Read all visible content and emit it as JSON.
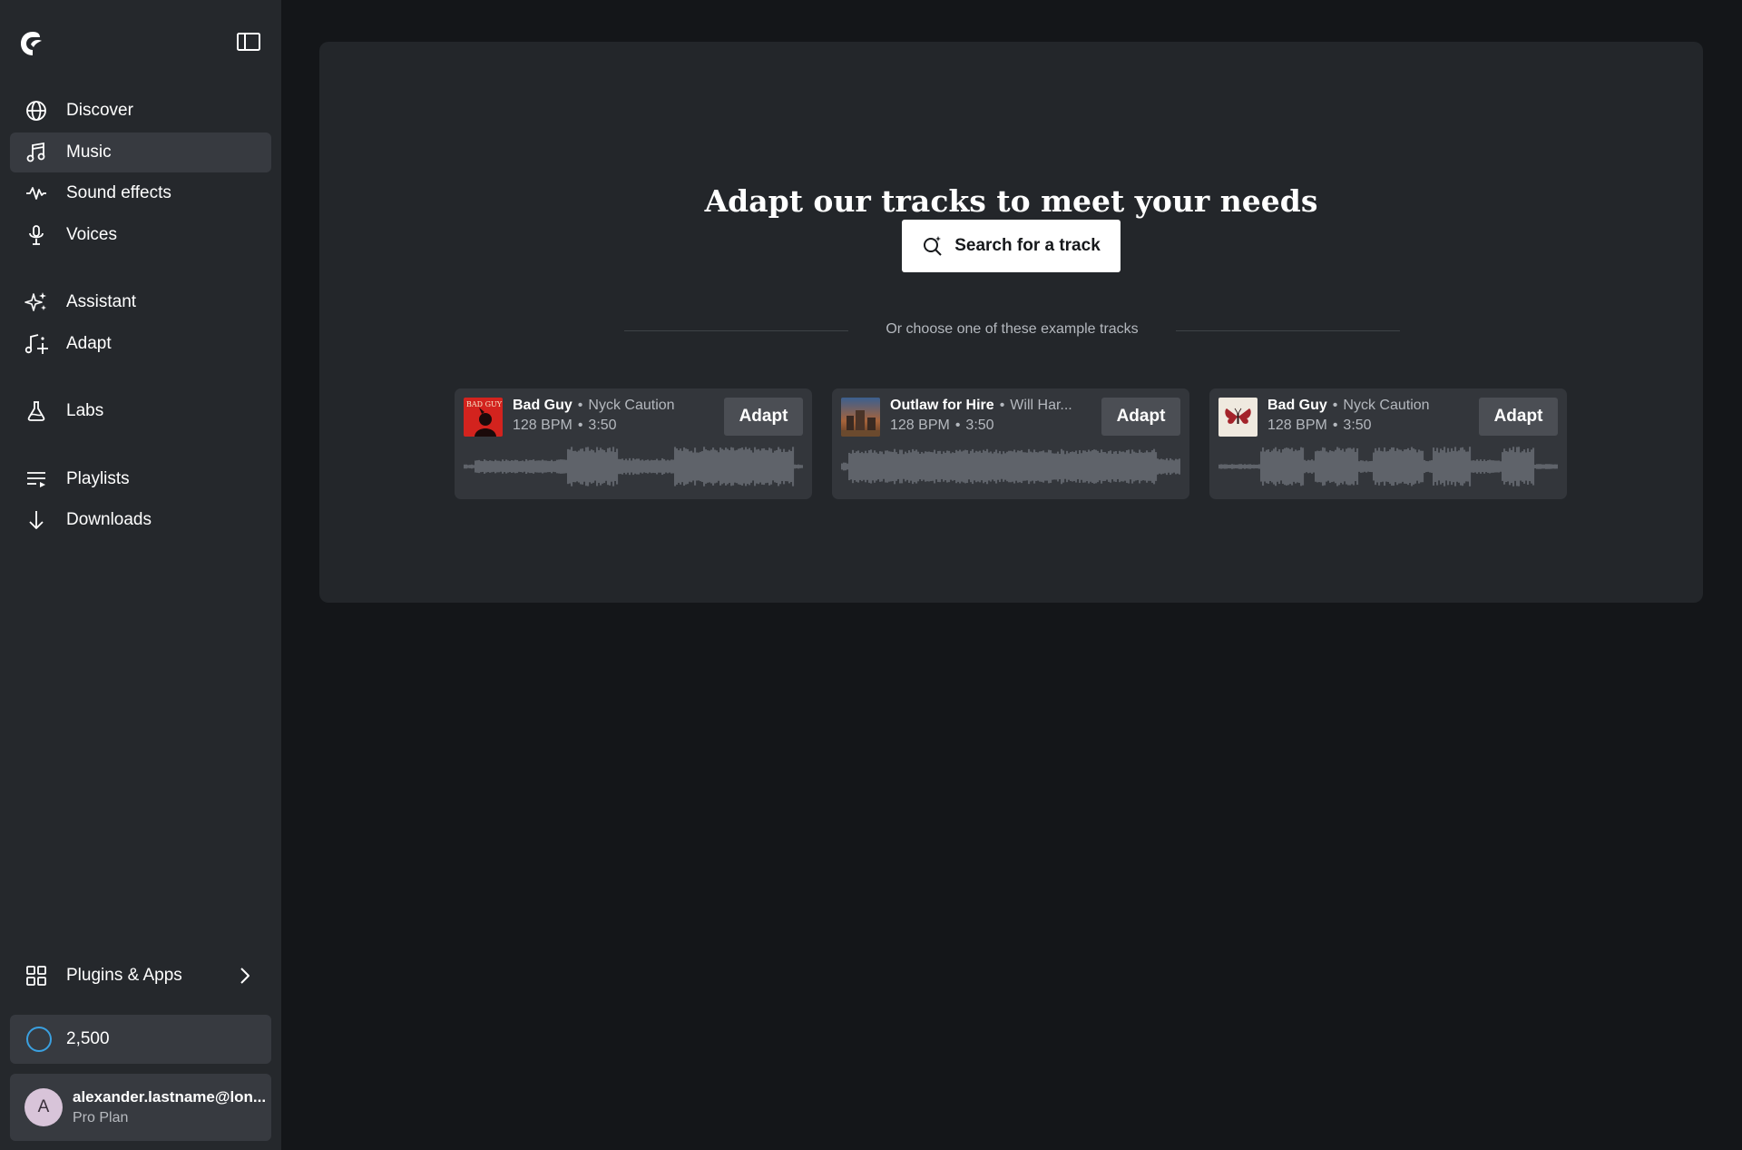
{
  "sidebar": {
    "nav_groups": [
      [
        {
          "label": "Discover",
          "icon": "globe-icon",
          "active": false
        },
        {
          "label": "Music",
          "icon": "music-note-icon",
          "active": true
        },
        {
          "label": "Sound effects",
          "icon": "waveform-icon",
          "active": false
        },
        {
          "label": "Voices",
          "icon": "microphone-icon",
          "active": false
        }
      ],
      [
        {
          "label": "Assistant",
          "icon": "sparkles-icon",
          "active": false
        },
        {
          "label": "Adapt",
          "icon": "music-adapt-icon",
          "active": false
        }
      ],
      [
        {
          "label": "Labs",
          "icon": "flask-icon",
          "active": false
        }
      ],
      [
        {
          "label": "Playlists",
          "icon": "playlist-icon",
          "active": false
        },
        {
          "label": "Downloads",
          "icon": "download-icon",
          "active": false
        }
      ]
    ],
    "plugins_label": "Plugins & Apps",
    "credits": "2,500",
    "account": {
      "initial": "A",
      "email": "alexander.lastname@lon...",
      "plan": "Pro Plan"
    }
  },
  "main": {
    "headline": "Adapt our tracks to meet your needs",
    "search_label": "Search for a track",
    "divider_text": "Or choose one of these example tracks",
    "tracks": [
      {
        "title": "Bad Guy",
        "artist": "Nyck Caution",
        "bpm": "128 BPM",
        "duration": "3:50",
        "adapt_label": "Adapt",
        "cover_text": "BAD GUY"
      },
      {
        "title": "Outlaw for Hire",
        "artist": "Will Har...",
        "bpm": "128 BPM",
        "duration": "3:50",
        "adapt_label": "Adapt"
      },
      {
        "title": "Bad Guy",
        "artist": "Nyck Caution",
        "bpm": "128 BPM",
        "duration": "3:50",
        "adapt_label": "Adapt"
      }
    ]
  },
  "colors": {
    "background": "#141619",
    "sidebar": "#25282c",
    "panel": "#23262a",
    "card": "#33363b",
    "active_item": "#373a40",
    "credits_ring": "#3aa0e0"
  }
}
